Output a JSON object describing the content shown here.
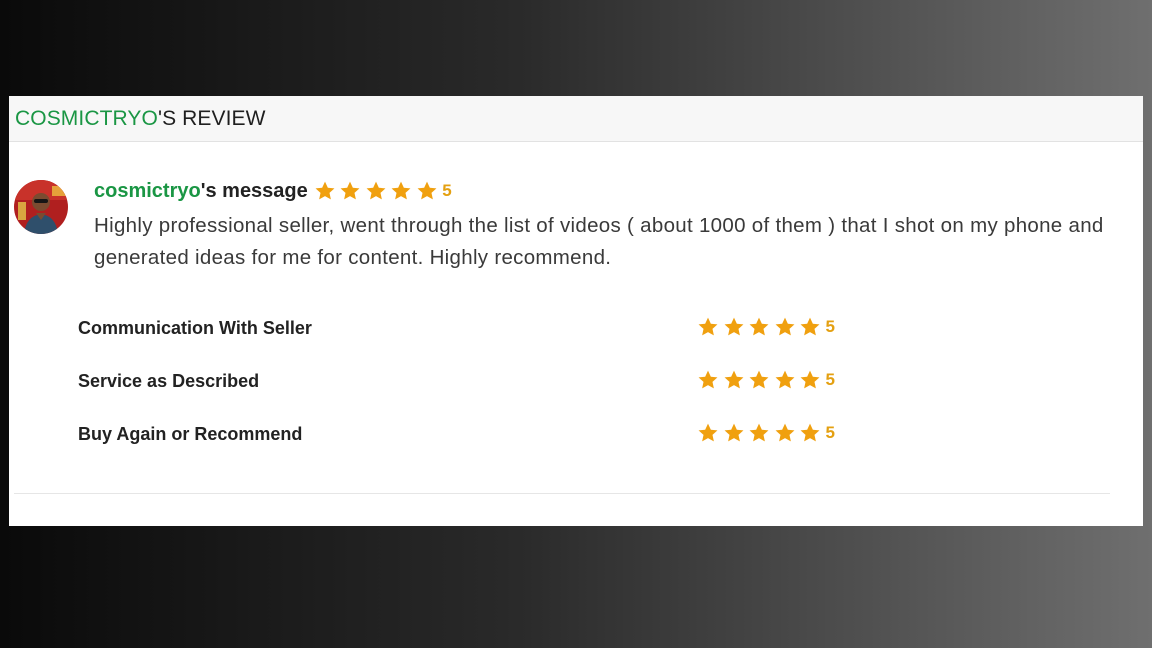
{
  "review": {
    "header": {
      "username": "COSMICTRYO",
      "suffix": "'S REVIEW"
    },
    "message": {
      "username": "cosmictryo",
      "title_suffix": "'s message",
      "rating": "5",
      "text": "Highly professional seller, went through the list of videos ( about 1000 of them ) that I shot on my phone and generated ideas for me for content. Highly recommend."
    },
    "ratings": [
      {
        "label": "Communication With Seller",
        "score": "5"
      },
      {
        "label": "Service as Described",
        "score": "5"
      },
      {
        "label": "Buy Again or Recommend",
        "score": "5"
      }
    ],
    "colors": {
      "username": "#1a9644",
      "star": "#f0a00f"
    }
  }
}
